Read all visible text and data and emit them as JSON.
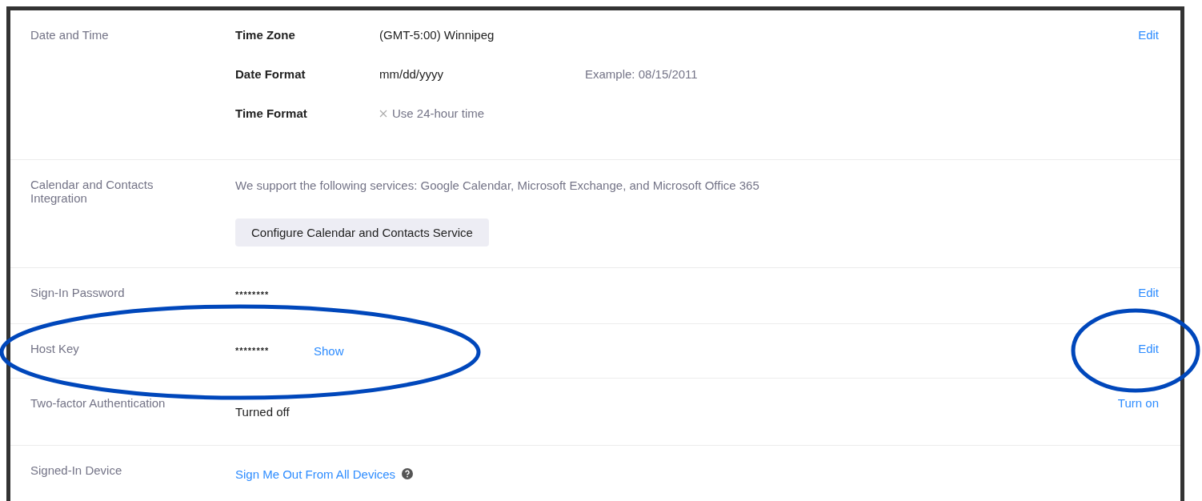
{
  "sections": [
    {
      "label": "Date and Time",
      "action": "Edit",
      "lines": [
        {
          "kind": "setting",
          "name": "Time Zone",
          "value": "(GMT-5:00) Winnipeg"
        },
        {
          "kind": "setting",
          "name": "Date Format",
          "value": "mm/dd/yyyy",
          "note": "Example: 08/15/2011"
        },
        {
          "kind": "option",
          "name": "Time Format",
          "value": "Use 24-hour time",
          "checked": false
        }
      ]
    },
    {
      "label": "Calendar and Contacts Integration",
      "lines": [
        {
          "kind": "text",
          "value": "We support the following services: Google Calendar, Microsoft Exchange, and Microsoft Office 365"
        },
        {
          "kind": "button",
          "value": "Configure Calendar and Contacts Service"
        }
      ]
    },
    {
      "label": "Sign-In Password",
      "action": "Edit",
      "lines": [
        {
          "kind": "secret",
          "value": "********"
        }
      ]
    },
    {
      "label": "Host Key",
      "action": "Edit",
      "lines": [
        {
          "kind": "secret",
          "value": "********",
          "link": "Show"
        }
      ]
    },
    {
      "label": "Two-factor Authentication",
      "action": "Turn on",
      "lines": [
        {
          "kind": "status",
          "value": "Turned off"
        }
      ]
    },
    {
      "label": "Signed-In Device",
      "lines": [
        {
          "kind": "link",
          "value": "Sign Me Out From All Devices",
          "help": true
        }
      ]
    }
  ],
  "annotations": [
    {
      "kind": "ellipse"
    },
    {
      "kind": "ellipse"
    }
  ]
}
